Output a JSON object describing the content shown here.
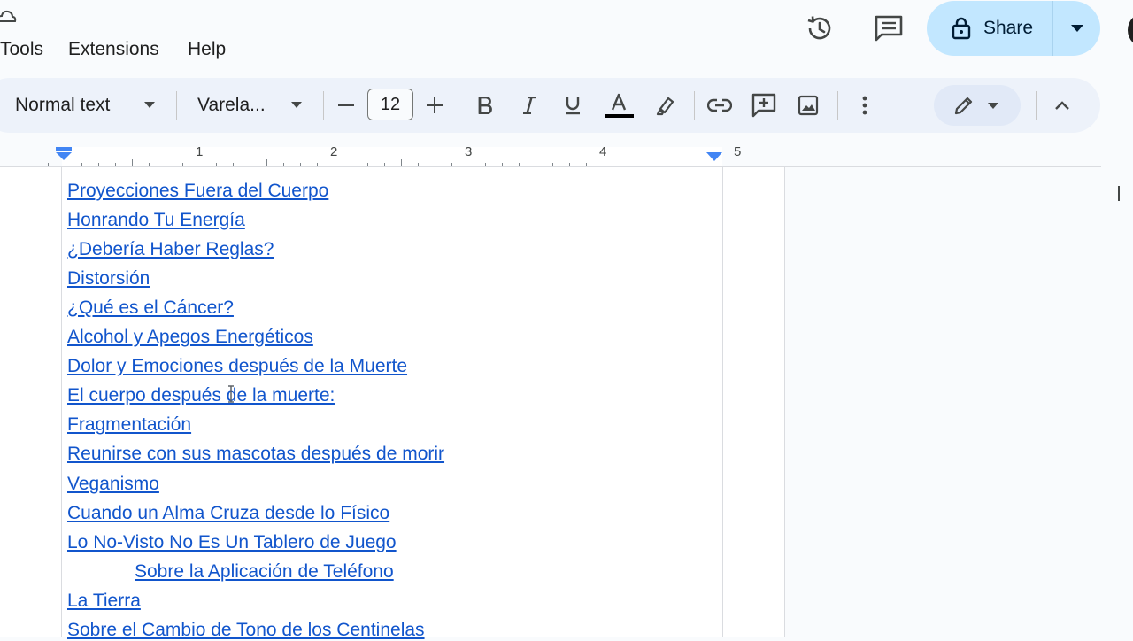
{
  "menu": {
    "tools": "Tools",
    "extensions": "Extensions",
    "help": "Help"
  },
  "share": {
    "label": "Share"
  },
  "toolbar": {
    "style": "Normal text",
    "font": "Varela...",
    "font_size": "12"
  },
  "ruler": {
    "numbers": [
      "1",
      "2",
      "3",
      "4",
      "5"
    ]
  },
  "document": {
    "links": [
      "Proyecciones Fuera del Cuerpo",
      "Honrando Tu Energía",
      "¿Debería Haber Reglas?",
      "Distorsión",
      "¿Qué es el Cáncer?",
      "Alcohol y Apegos Energéticos",
      "Dolor y Emociones después de la Muerte",
      "El cuerpo después de la muerte:",
      "Fragmentación",
      "Reunirse con sus mascotas después de morir",
      "Veganismo",
      "Cuando un Alma Cruza desde lo Físico",
      "Lo No-Visto No Es Un Tablero de Juego",
      "Sobre la Aplicación de Teléfono",
      "La Tierra",
      "Sobre el Cambio de Tono de los Centinelas"
    ]
  },
  "colors": {
    "link": "#1155cc",
    "share_bg": "#c2e7ff",
    "toolbar_bg": "#edf2fa",
    "ruler_marker": "#4285f4"
  },
  "icons": {
    "cloud": "cloud-icon",
    "history": "history-icon",
    "comments": "comment-icon",
    "lock": "lock-icon",
    "dropdown": "caret-down-icon",
    "minus": "minus-icon",
    "plus": "plus-icon",
    "bold": "bold-icon",
    "italic": "italic-icon",
    "underline": "underline-icon",
    "text_color": "text-color-icon",
    "highlight": "highlighter-icon",
    "link": "link-icon",
    "add_comment": "add-comment-icon",
    "image": "image-icon",
    "more": "more-vert-icon",
    "edit_mode": "pencil-icon",
    "collapse": "chevron-up-icon"
  }
}
